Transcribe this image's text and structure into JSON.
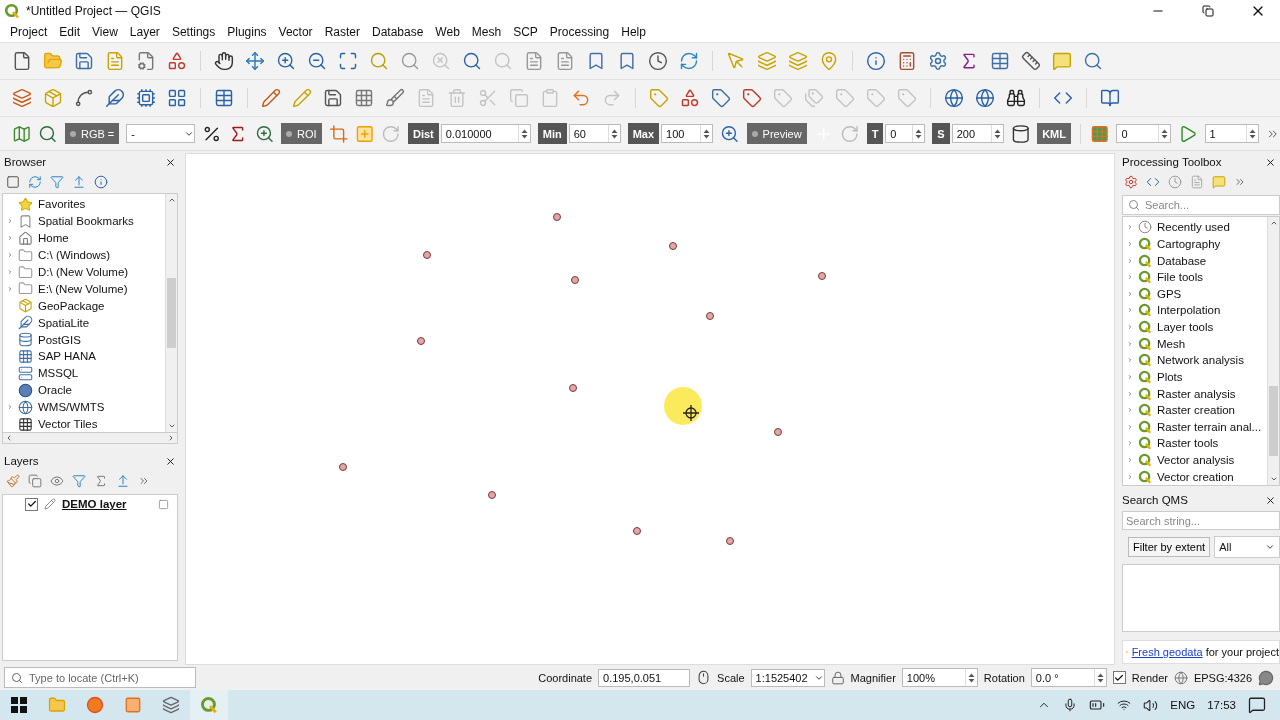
{
  "window": {
    "title": "*Untitled Project — QGIS"
  },
  "menu": [
    "Project",
    "Edit",
    "View",
    "Layer",
    "Settings",
    "Plugins",
    "Vector",
    "Raster",
    "Database",
    "Web",
    "Mesh",
    "SCP",
    "Processing",
    "Help"
  ],
  "scp_toolbar": {
    "band_set_label": "RGB =",
    "band_set_value": "-",
    "roi_button": "ROI",
    "dist_label": "Dist",
    "dist_value": "0.010000",
    "min_label": "Min",
    "min_value": "60",
    "max_label": "Max",
    "max_value": "100",
    "preview_button": "Preview",
    "t_label": "T",
    "t_value": "0",
    "s_label": "S",
    "s_value": "200",
    "kml_label": "KML",
    "band_value": "0",
    "step_value": "1"
  },
  "browser": {
    "title": "Browser",
    "items": [
      {
        "label": "Favorites",
        "expandable": false
      },
      {
        "label": "Spatial Bookmarks",
        "expandable": true
      },
      {
        "label": "Home",
        "expandable": true
      },
      {
        "label": "C:\\ (Windows)",
        "expandable": true
      },
      {
        "label": "D:\\ (New Volume)",
        "expandable": true
      },
      {
        "label": "E:\\ (New Volume)",
        "expandable": true
      },
      {
        "label": "GeoPackage",
        "expandable": false
      },
      {
        "label": "SpatiaLite",
        "expandable": false
      },
      {
        "label": "PostGIS",
        "expandable": false
      },
      {
        "label": "SAP HANA",
        "expandable": false
      },
      {
        "label": "MSSQL",
        "expandable": false
      },
      {
        "label": "Oracle",
        "expandable": false
      },
      {
        "label": "WMS/WMTS",
        "expandable": true
      },
      {
        "label": "Vector Tiles",
        "expandable": false
      }
    ]
  },
  "layers": {
    "title": "Layers",
    "items": [
      {
        "name": "DEMO layer",
        "checked": true
      }
    ]
  },
  "processing_toolbox": {
    "title": "Processing Toolbox",
    "search_placeholder": "Search...",
    "items": [
      {
        "label": "Recently used",
        "kind": "recent"
      },
      {
        "label": "Cartography",
        "kind": "provider"
      },
      {
        "label": "Database",
        "kind": "provider"
      },
      {
        "label": "File tools",
        "kind": "provider"
      },
      {
        "label": "GPS",
        "kind": "provider"
      },
      {
        "label": "Interpolation",
        "kind": "provider"
      },
      {
        "label": "Layer tools",
        "kind": "provider"
      },
      {
        "label": "Mesh",
        "kind": "provider"
      },
      {
        "label": "Network analysis",
        "kind": "provider"
      },
      {
        "label": "Plots",
        "kind": "provider"
      },
      {
        "label": "Raster analysis",
        "kind": "provider"
      },
      {
        "label": "Raster creation",
        "kind": "provider"
      },
      {
        "label": "Raster terrain anal...",
        "kind": "provider"
      },
      {
        "label": "Raster tools",
        "kind": "provider"
      },
      {
        "label": "Vector analysis",
        "kind": "provider"
      },
      {
        "label": "Vector creation",
        "kind": "provider"
      }
    ]
  },
  "search_qms": {
    "title": "Search QMS",
    "placeholder": "Search string...",
    "filter_button": "Filter by extent",
    "filter_value": "All",
    "link": "Fresh geodata",
    "message": "for your project"
  },
  "status_bar": {
    "locator_placeholder": "Type to locate (Ctrl+K)",
    "coordinate_label": "Coordinate",
    "coordinate": "0.195,0.051",
    "scale_label": "Scale",
    "scale": "1:1525402",
    "magnifier_label": "Magnifier",
    "magnifier": "100%",
    "rotation_label": "Rotation",
    "rotation": "0.0 °",
    "render_label": "Render",
    "render_checked": true,
    "crs": "EPSG:4326"
  },
  "taskbar": {
    "language": "ENG",
    "time": "17:53"
  }
}
